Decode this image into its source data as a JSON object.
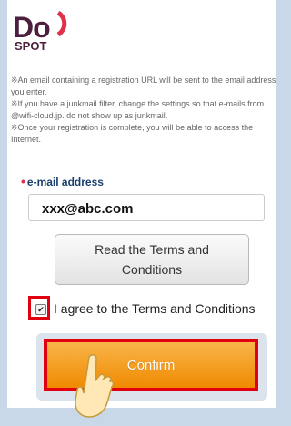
{
  "logo": {
    "top": "Do",
    "bottom": "SPOT"
  },
  "notes": [
    "※An email containing a registration URL will be sent to the email address you enter.",
    "※If you have a junkmail filter, change the settings so that e-mails from @wifi-cloud.jp. do not show up as junkmail.",
    "※Once your registration is complete, you will be able to access the Internet."
  ],
  "form": {
    "email_label": "e-mail address",
    "email_value": "xxx@abc.com",
    "terms_button": "Read the Terms and Conditions",
    "agree_label": "I agree to the Terms and Conditions",
    "agree_checked": true,
    "confirm_button": "Confirm"
  },
  "colors": {
    "highlight": "#e0000f",
    "confirm": "#f39200",
    "label": "#1a3f6e",
    "brand": "#4b1f3d"
  }
}
